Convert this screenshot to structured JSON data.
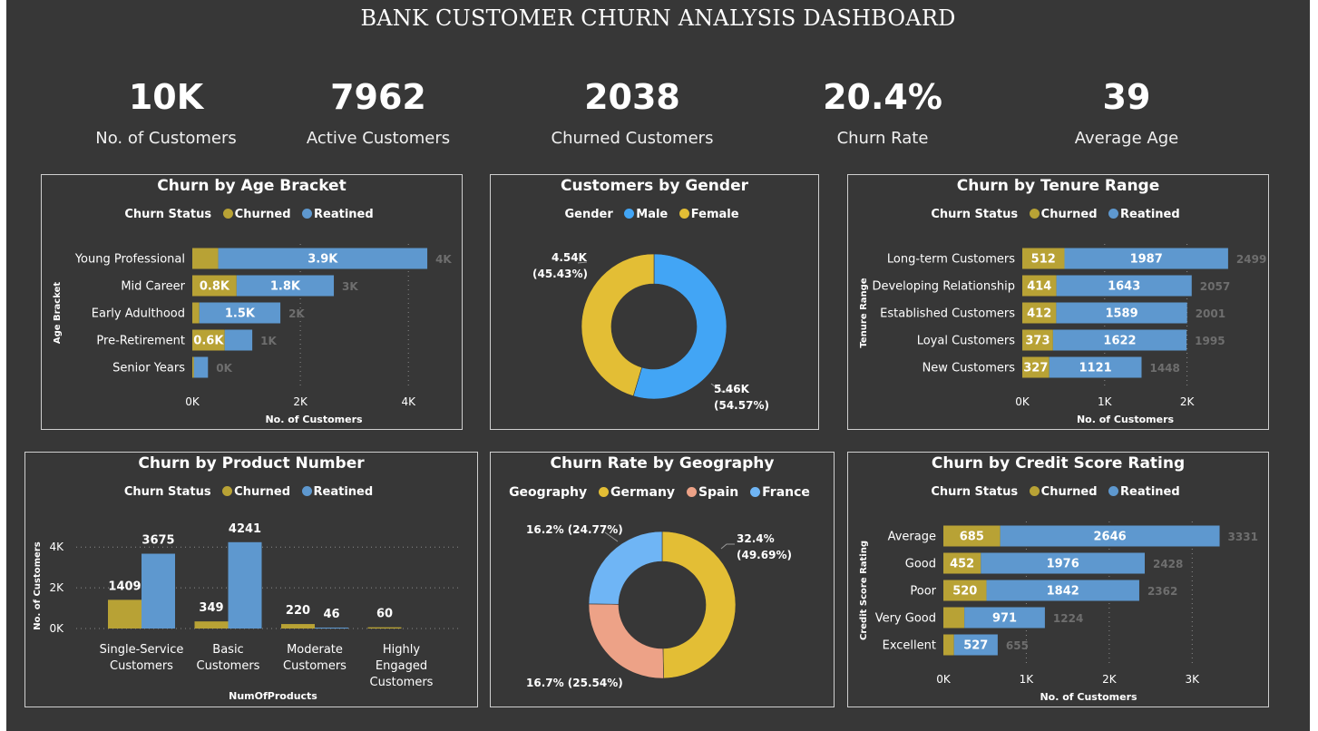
{
  "title": "BANK CUSTOMER CHURN ANALYSIS DASHBOARD",
  "colors": {
    "churned": "#B8A235",
    "retained": "#5E98CF",
    "male": "#42A5F5",
    "female": "#E3BE35",
    "germany": "#E3BE35",
    "spain": "#EDA287",
    "france": "#6FB5F5"
  },
  "kpis": [
    {
      "value": "10K",
      "label": "No. of Customers"
    },
    {
      "value": "7962",
      "label": "Active Customers"
    },
    {
      "value": "2038",
      "label": "Churned Customers"
    },
    {
      "value": "20.4%",
      "label": "Churn Rate"
    },
    {
      "value": "39",
      "label": "Average Age"
    }
  ],
  "legends": {
    "churn_title": "Churn Status",
    "churned": "Churned",
    "retained": "Reatined",
    "gender_title": "Gender",
    "male": "Male",
    "female": "Female",
    "geo_title": "Geography",
    "germany": "Germany",
    "spain": "Spain",
    "france": "France"
  },
  "chart_data": [
    {
      "id": "age",
      "type": "bar",
      "orientation": "horizontal",
      "stacked": true,
      "title": "Churn by Age Bracket",
      "xlabel": "No. of Customers",
      "ylabel": "Age Bracket",
      "xlim": [
        0,
        4500
      ],
      "ticks": [
        {
          "value": 0,
          "label": "0K"
        },
        {
          "value": 2000,
          "label": "2K"
        },
        {
          "value": 4000,
          "label": "4K"
        }
      ],
      "categories": [
        "Young Professional",
        "Mid Career",
        "Early Adulthood",
        "Pre-Retirement",
        "Senior Years"
      ],
      "series": [
        {
          "name": "Churned",
          "values": [
            480,
            820,
            130,
            600,
            30
          ],
          "labels": [
            "",
            "0.8K",
            "",
            "0.6K",
            ""
          ]
        },
        {
          "name": "Reatined",
          "values": [
            3870,
            1800,
            1500,
            510,
            260
          ],
          "labels": [
            "3.9K",
            "1.8K",
            "1.5K",
            "",
            ""
          ]
        }
      ],
      "totals": [
        "4K",
        "3K",
        "2K",
        "1K",
        "0K"
      ],
      "legend": "top-center",
      "grid": true
    },
    {
      "id": "gender",
      "type": "pie",
      "donut": true,
      "title": "Customers by Gender",
      "slices": [
        {
          "name": "Male",
          "value": 5.46,
          "label_value": "5.46K",
          "label_pct": "(54.57%)"
        },
        {
          "name": "Female",
          "value": 4.54,
          "label_value": "4.54K",
          "label_pct": "(45.43%)"
        }
      ],
      "legend": "top-center"
    },
    {
      "id": "tenure",
      "type": "bar",
      "orientation": "horizontal",
      "stacked": true,
      "title": "Churn by Tenure Range",
      "xlabel": "No. of Customers",
      "ylabel": "Tenure Range",
      "xlim": [
        0,
        2500
      ],
      "ticks": [
        {
          "value": 0,
          "label": "0K"
        },
        {
          "value": 1000,
          "label": "1K"
        },
        {
          "value": 2000,
          "label": "2K"
        }
      ],
      "categories": [
        "Long-term Customers",
        "Developing Relationship",
        "Established Customers",
        "Loyal Customers",
        "New Customers"
      ],
      "series": [
        {
          "name": "Churned",
          "values": [
            512,
            414,
            412,
            373,
            327
          ],
          "labels": [
            "512",
            "414",
            "412",
            "373",
            "327"
          ]
        },
        {
          "name": "Reatined",
          "values": [
            1987,
            1643,
            1589,
            1622,
            1121
          ],
          "labels": [
            "1987",
            "1643",
            "1589",
            "1622",
            "1121"
          ]
        }
      ],
      "totals": [
        "2499",
        "2057",
        "2001",
        "1995",
        "1448"
      ],
      "legend": "top-center",
      "grid": true
    },
    {
      "id": "product",
      "type": "bar",
      "orientation": "vertical",
      "stacked": false,
      "title": "Churn by Product Number",
      "xlabel": "NumOfProducts",
      "ylabel": "No. of Customers",
      "ylim": [
        0,
        4500
      ],
      "ticks": [
        {
          "value": 0,
          "label": "0K"
        },
        {
          "value": 2000,
          "label": "2K"
        },
        {
          "value": 4000,
          "label": "4K"
        }
      ],
      "categories": [
        [
          "Single-Service",
          "Customers"
        ],
        [
          "Basic",
          "Customers"
        ],
        [
          "Moderate",
          "Customers"
        ],
        [
          "Highly",
          "Engaged",
          "Customers"
        ]
      ],
      "series": [
        {
          "name": "Churned",
          "values": [
            1409,
            349,
            220,
            60
          ],
          "labels": [
            "1409",
            "349",
            "220",
            "60"
          ]
        },
        {
          "name": "Reatined",
          "values": [
            3675,
            4241,
            46,
            0
          ],
          "labels": [
            "3675",
            "4241",
            "46",
            ""
          ]
        }
      ],
      "legend": "top-center",
      "grid": true
    },
    {
      "id": "geo",
      "type": "pie",
      "donut": true,
      "title": "Churn Rate by Geography",
      "slices": [
        {
          "name": "Germany",
          "value": 49.69,
          "label": "32.4%",
          "label_pct": "(49.69%)"
        },
        {
          "name": "Spain",
          "value": 25.54,
          "label": "16.7% (25.54%)"
        },
        {
          "name": "France",
          "value": 24.77,
          "label": "16.2% (24.77%)"
        }
      ],
      "legend": "top-center"
    },
    {
      "id": "credit",
      "type": "bar",
      "orientation": "horizontal",
      "stacked": true,
      "title": "Churn by Credit Score Rating",
      "xlabel": "No. of Customers",
      "ylabel": "Credit Score Rating",
      "xlim": [
        0,
        3500
      ],
      "ticks": [
        {
          "value": 0,
          "label": "0K"
        },
        {
          "value": 1000,
          "label": "1K"
        },
        {
          "value": 2000,
          "label": "2K"
        },
        {
          "value": 3000,
          "label": "3K"
        }
      ],
      "categories": [
        "Average",
        "Good",
        "Poor",
        "Very Good",
        "Excellent"
      ],
      "series": [
        {
          "name": "Churned",
          "values": [
            685,
            452,
            520,
            253,
            128
          ],
          "labels": [
            "685",
            "452",
            "520",
            "",
            ""
          ]
        },
        {
          "name": "Reatined",
          "values": [
            2646,
            1976,
            1842,
            971,
            527
          ],
          "labels": [
            "2646",
            "1976",
            "1842",
            "971",
            "527"
          ]
        }
      ],
      "totals": [
        "3331",
        "2428",
        "2362",
        "1224",
        "655"
      ],
      "legend": "top-center",
      "grid": true
    }
  ]
}
